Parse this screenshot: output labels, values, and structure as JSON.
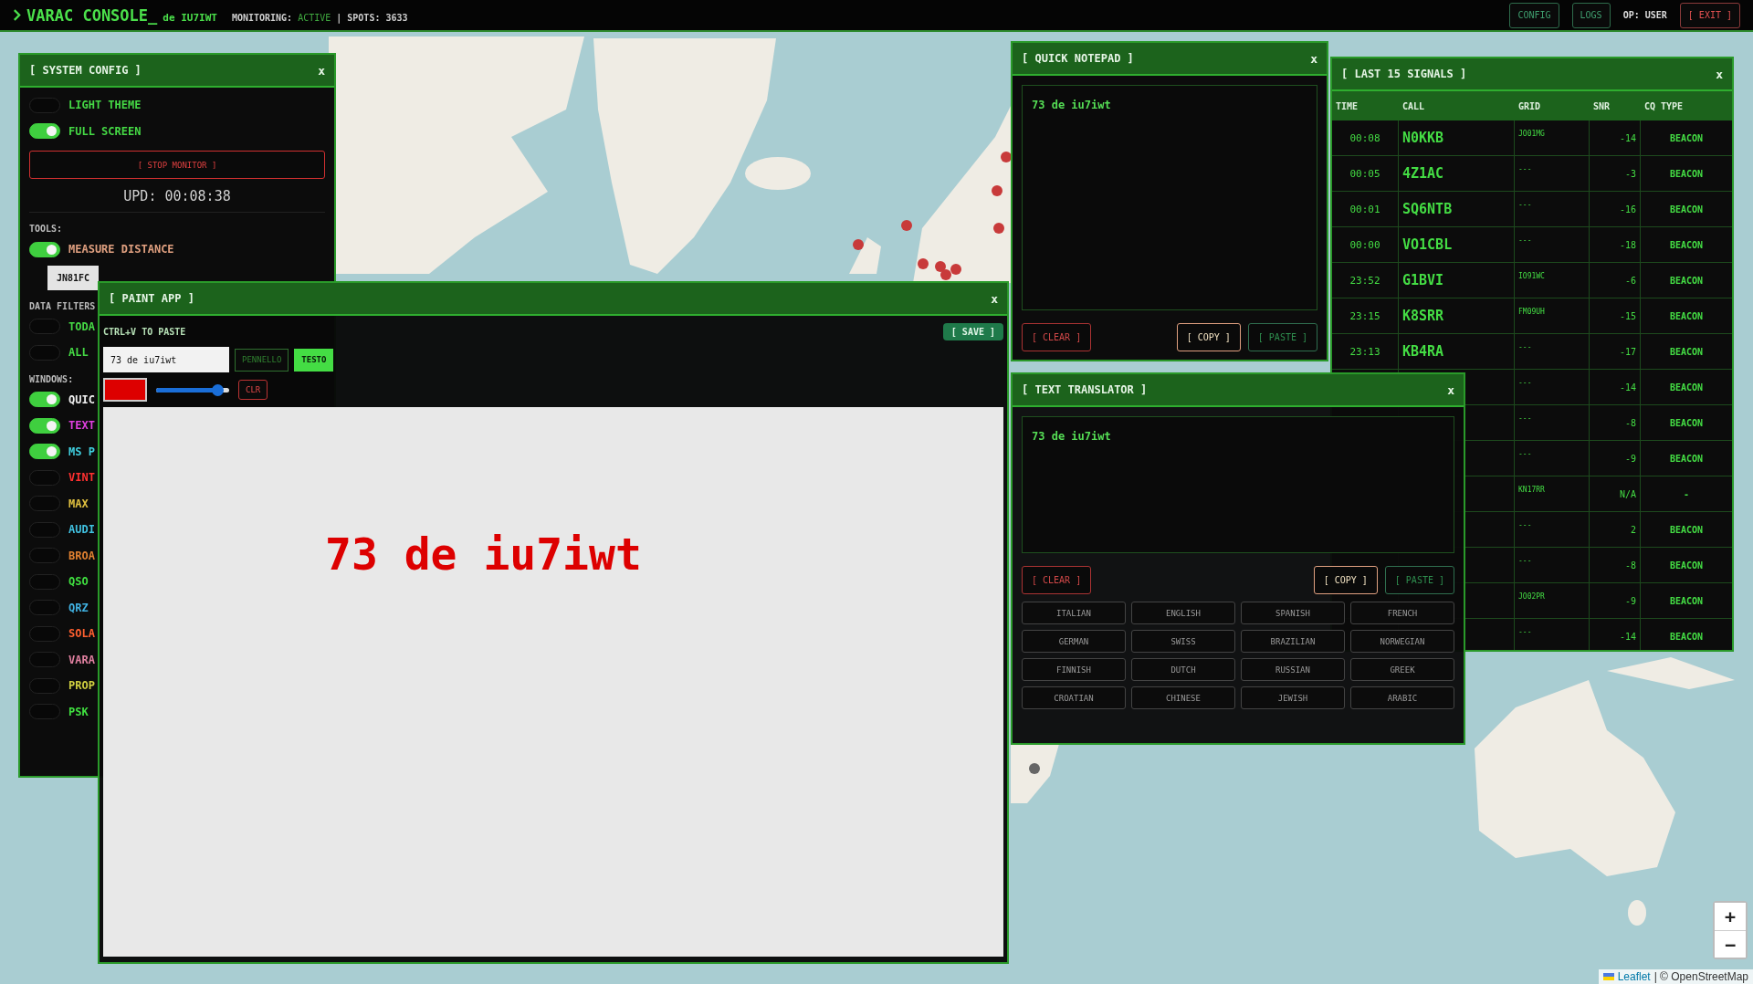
{
  "top_bar": {
    "title": "VARAC CONSOLE_",
    "callsign": "de IU7IWT",
    "monitoring_label": "MONITORING:",
    "monitoring_status": "ACTIVE",
    "separator": "|",
    "spots": "SPOTS: 3633",
    "buttons": [
      {
        "label": "CONFIG"
      },
      {
        "label": "LOGS"
      }
    ],
    "operator": "OP: USER",
    "exit_button": "[ EXIT ]"
  },
  "system_config": {
    "title": "[ SYSTEM CONFIG ]",
    "close": "x",
    "display_toggles": [
      {
        "label": "LIGHT THEME",
        "on": false,
        "color": "#45d945"
      },
      {
        "label": "FULL SCREEN",
        "on": true,
        "color": "#45d945"
      }
    ],
    "stop_button": "[ STOP MONITOR ]",
    "update": "UPD: 00:08:38",
    "tools_label": "TOOLS:",
    "tool_toggles": [
      {
        "label": "MEASURE DISTANCE",
        "on": true,
        "color": "#e0a080"
      }
    ],
    "grid_field": "JN81FC",
    "filters_label": "DATA FILTERS",
    "filter_toggles": [
      {
        "label": "TODA",
        "on": false,
        "color": "#45d945"
      },
      {
        "label": "ALL",
        "on": false,
        "color": "#45d945"
      }
    ],
    "windows_label": "WINDOWS:",
    "window_toggles": [
      {
        "label": "QUIC",
        "on": true,
        "color": "#f0f0f0"
      },
      {
        "label": "TEXT",
        "on": true,
        "color": "#e040e0"
      },
      {
        "label": "MS P",
        "on": true,
        "color": "#40d0e0"
      },
      {
        "label": "VINT",
        "on": false,
        "color": "#ff3030"
      },
      {
        "label": "MAX",
        "on": false,
        "color": "#e0c040"
      },
      {
        "label": "AUDI",
        "on": false,
        "color": "#40c0e0"
      },
      {
        "label": "BROA",
        "on": false,
        "color": "#e08030"
      },
      {
        "label": "QSO",
        "on": false,
        "color": "#40e040"
      },
      {
        "label": "QRZ",
        "on": false,
        "color": "#40b0e0"
      },
      {
        "label": "SOLA",
        "on": false,
        "color": "#ff6030"
      },
      {
        "label": "VARA",
        "on": false,
        "color": "#e080a0"
      },
      {
        "label": "PROP",
        "on": false,
        "color": "#d0d040"
      },
      {
        "label": "PSK",
        "on": false,
        "color": "#40e040"
      }
    ]
  },
  "paint_app": {
    "title": "[ PAINT APP ]",
    "close": "x",
    "hint": "CTRL+V TO PASTE",
    "save_button": "[ SAVE ]",
    "text_field": "73 de iu7iwt",
    "modes": [
      {
        "label": "PENNELLO",
        "selected": false
      },
      {
        "label": "TESTO",
        "selected": true
      }
    ],
    "color": "#dd0000",
    "size_slider": {
      "level": 0.85
    },
    "clear_button": "CLR",
    "canvas_text": "73 de iu7iwt"
  },
  "quick_notepad": {
    "title": "[ QUICK NOTEPAD ]",
    "close": "x",
    "text": "73 de iu7iwt",
    "buttons": [
      {
        "label": "[ CLEAR ]",
        "kind": "danger"
      },
      {
        "label": "[ COPY ]",
        "kind": "accent"
      },
      {
        "label": "[ PASTE ]",
        "kind": "muted"
      }
    ]
  },
  "signals": {
    "title": "[ LAST 15 SIGNALS ]",
    "close": "x",
    "columns": [
      "TIME",
      "CALL",
      "GRID",
      "SNR",
      "CQ TYPE"
    ],
    "rows": [
      {
        "time": "00:08",
        "call": "N0KKB",
        "grid": "JO01MG",
        "snr": "-14",
        "cq_type": "BEACON"
      },
      {
        "time": "00:05",
        "call": "4Z1AC",
        "grid": "---",
        "snr": "-3",
        "cq_type": "BEACON"
      },
      {
        "time": "00:01",
        "call": "SQ6NTB",
        "grid": "---",
        "snr": "-16",
        "cq_type": "BEACON"
      },
      {
        "time": "00:00",
        "call": "VO1CBL",
        "grid": "---",
        "snr": "-18",
        "cq_type": "BEACON"
      },
      {
        "time": "23:52",
        "call": "G1BVI",
        "grid": "IO91WC",
        "snr": "-6",
        "cq_type": "BEACON"
      },
      {
        "time": "23:15",
        "call": "K8SRR",
        "grid": "FM09UH",
        "snr": "-15",
        "cq_type": "BEACON"
      },
      {
        "time": "23:13",
        "call": "KB4RA",
        "grid": "---",
        "snr": "-17",
        "cq_type": "BEACON"
      },
      {
        "grid": "---",
        "snr": "-14",
        "cq_type": "BEACON"
      },
      {
        "grid": "---",
        "snr": "-8",
        "cq_type": "BEACON"
      },
      {
        "grid": "---",
        "snr": "-9",
        "cq_type": "BEACON"
      },
      {
        "grid": "KN17RR",
        "snr": "N/A",
        "cq_type": "-"
      },
      {
        "grid": "---",
        "snr": "2",
        "cq_type": "BEACON"
      },
      {
        "grid": "---",
        "snr": "-8",
        "cq_type": "BEACON"
      },
      {
        "grid": "JO02PR",
        "snr": "-9",
        "cq_type": "BEACON"
      },
      {
        "grid": "---",
        "snr": "-14",
        "cq_type": "BEACON"
      }
    ]
  },
  "translator": {
    "title": "[ TEXT TRANSLATOR ]",
    "close": "x",
    "text": "73 de iu7iwt",
    "buttons": [
      {
        "label": "[ CLEAR ]",
        "kind": "danger"
      },
      {
        "label": "[ COPY ]",
        "kind": "accent"
      },
      {
        "label": "[ PASTE ]",
        "kind": "muted"
      }
    ],
    "languages": [
      "ITALIAN",
      "ENGLISH",
      "SPANISH",
      "FRENCH",
      "GERMAN",
      "SWISS",
      "BRAZILIAN",
      "NORWEGIAN",
      "FINNISH",
      "DUTCH",
      "RUSSIAN",
      "GREEK",
      "CROATIAN",
      "CHINESE",
      "JEWISH",
      "ARABIC"
    ]
  },
  "map": {
    "zoom_in": "+",
    "zoom_out": "−",
    "attribution_link": "Leaflet",
    "attribution_text": "| © OpenStreetMap"
  }
}
